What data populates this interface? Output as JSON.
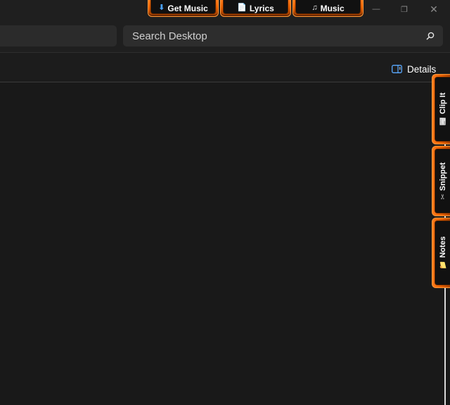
{
  "top_tabs": [
    {
      "icon": "⬇",
      "icon_name": "download-icon",
      "label": "Get Music"
    },
    {
      "icon": "📄",
      "icon_name": "document-icon",
      "label": "Lyrics"
    },
    {
      "icon": "♫",
      "icon_name": "music-note-icon",
      "label": "Music"
    }
  ],
  "window_controls": {
    "minimize": "—",
    "restore": "❐",
    "close": "✕"
  },
  "search": {
    "placeholder": "Search Desktop",
    "value": ""
  },
  "command_bar": {
    "details_label": "Details"
  },
  "side_tabs": [
    {
      "icon": "📰",
      "icon_name": "clip-icon",
      "label": "Clip It"
    },
    {
      "icon": "✂",
      "icon_name": "scissors-icon",
      "label": "Snippet"
    },
    {
      "icon": "📁",
      "icon_name": "folder-icon",
      "label": "Notes"
    }
  ],
  "colors": {
    "accent": "#e45f00",
    "accent_light": "#ff9a3c",
    "background": "#1c1c1c"
  }
}
